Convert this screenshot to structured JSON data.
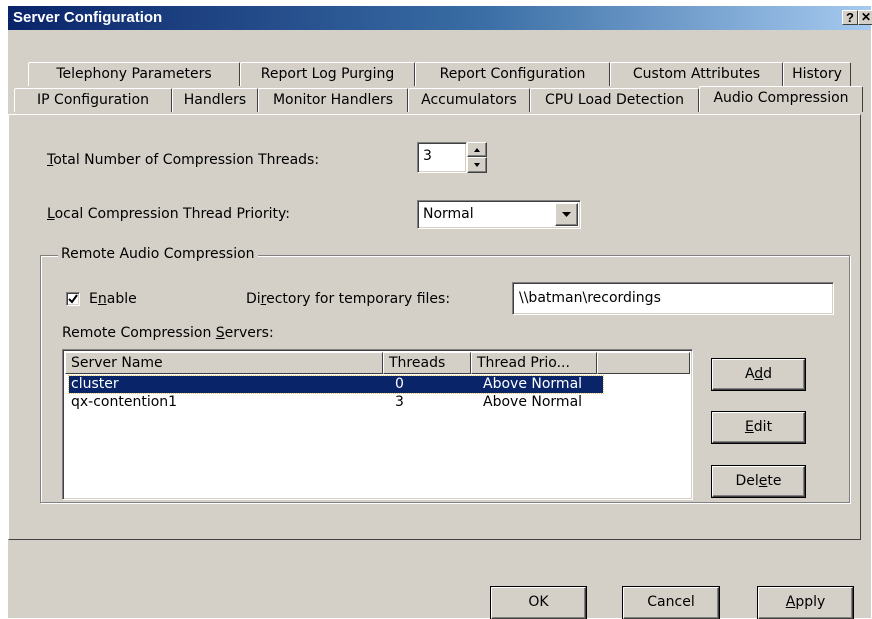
{
  "window": {
    "title": "Server Configuration",
    "help_glyph": "?",
    "close_glyph": "✕"
  },
  "tabs": {
    "back_row": [
      "Telephony Parameters",
      "Report Log Purging",
      "Report Configuration",
      "Custom Attributes",
      "History"
    ],
    "front_row": [
      "IP Configuration",
      "Handlers",
      "Monitor Handlers",
      "Accumulators",
      "CPU Load Detection",
      "Audio Compression"
    ],
    "active": "Audio Compression"
  },
  "compression": {
    "threads_label_pre": "",
    "threads_label_key": "T",
    "threads_label_post": "otal Number of Compression Threads:",
    "threads_value": "3",
    "priority_label_pre": "",
    "priority_label_key": "L",
    "priority_label_post": "ocal Compression Thread Priority:",
    "priority_value": "Normal"
  },
  "remote": {
    "group_label": "Remote Audio Compression",
    "enable_label_pre": "E",
    "enable_label_key": "n",
    "enable_label_post": "able",
    "enable_checked": true,
    "dir_label_pre": "Di",
    "dir_label_key": "r",
    "dir_label_post": "ectory for temporary files:",
    "dir_value": "\\\\batman\\recordings",
    "servers_label_pre": "Remote Compression ",
    "servers_label_key": "S",
    "servers_label_post": "ervers:",
    "columns": [
      "Server Name",
      "Threads",
      "Thread Prio..."
    ],
    "rows": [
      {
        "name": "cluster",
        "threads": "0",
        "priority": "Above Normal",
        "selected": true
      },
      {
        "name": "qx-contention1",
        "threads": "3",
        "priority": "Above Normal",
        "selected": false
      }
    ]
  },
  "side_buttons": {
    "add_pre": "A",
    "add_key": "d",
    "add_post": "d",
    "edit_pre": "",
    "edit_key": "E",
    "edit_post": "dit",
    "delete_pre": "Del",
    "delete_key": "e",
    "delete_post": "te"
  },
  "footer": {
    "ok_label": "OK",
    "cancel_label": "Cancel",
    "apply_pre": "",
    "apply_key": "A",
    "apply_post": "pply"
  }
}
